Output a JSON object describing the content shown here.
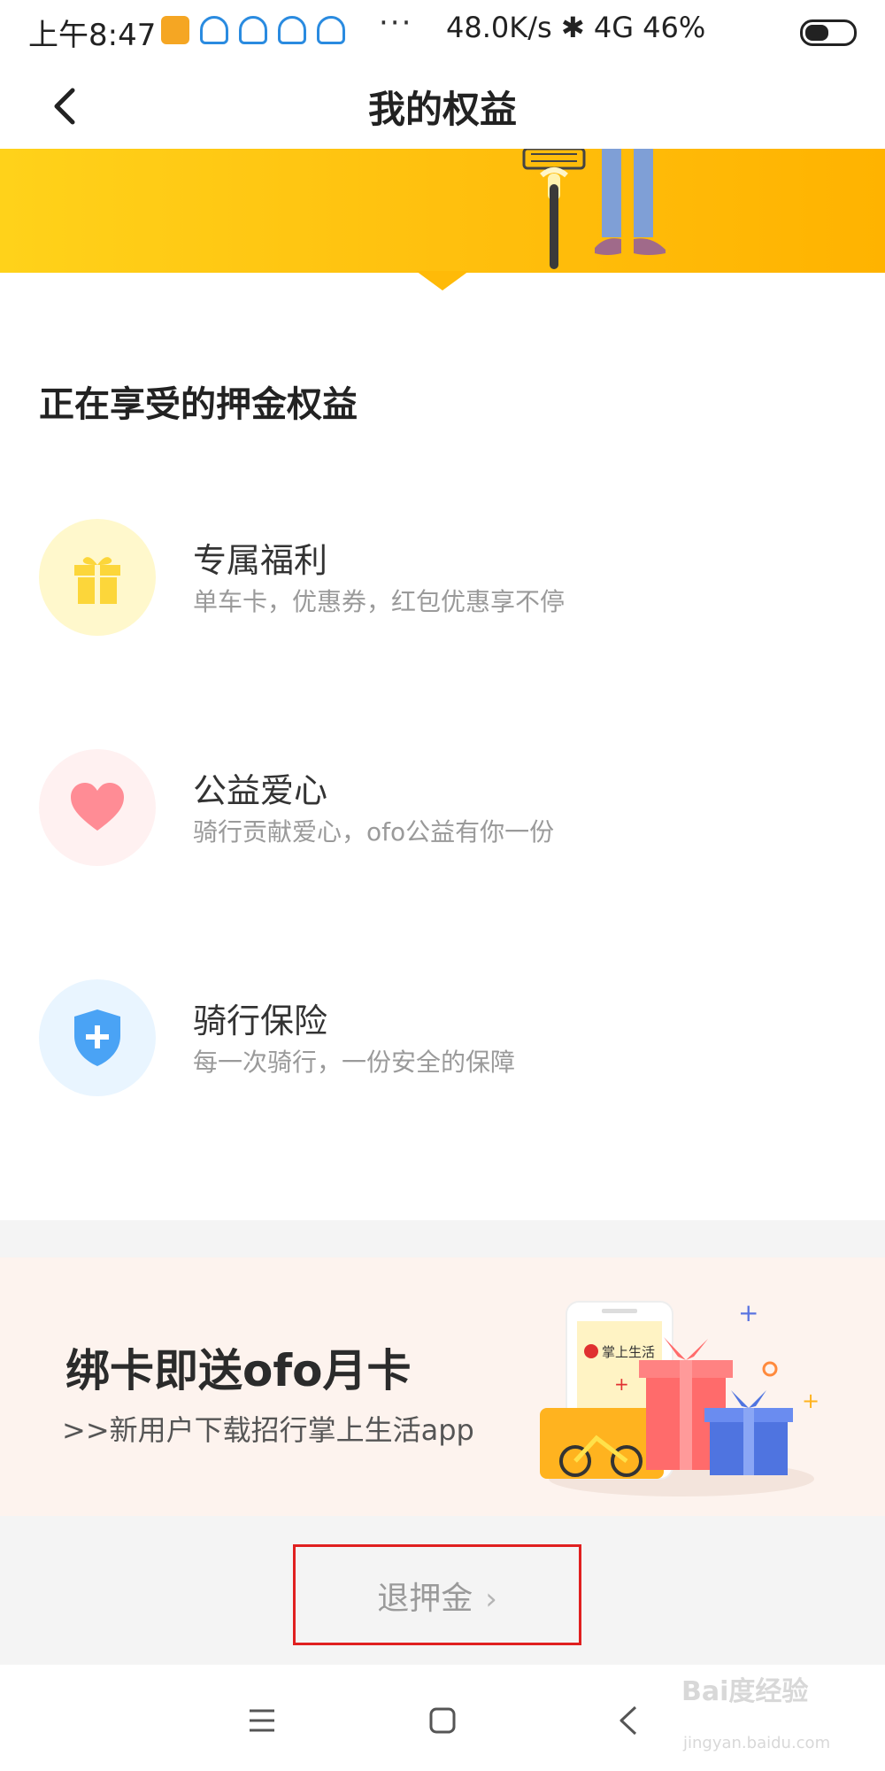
{
  "status_bar": {
    "time": "上午8:47",
    "dots": "···",
    "network": "48.0K/s ✱ 4G 46%"
  },
  "header": {
    "title": "我的权益",
    "back_icon": "chevron-left-icon"
  },
  "section": {
    "title": "正在享受的押金权益"
  },
  "benefits": [
    {
      "title": "专属福利",
      "desc": "单车卡，优惠券，红包优惠享不停",
      "icon": "gift-icon",
      "color": "#fcd63a"
    },
    {
      "title": "公益爱心",
      "desc": "骑行贡献爱心，ofo公益有你一份",
      "icon": "heart-icon",
      "color": "#ff8c95"
    },
    {
      "title": "骑行保险",
      "desc": "每一次骑行，一份安全的保障",
      "icon": "shield-icon",
      "color": "#4aa3f5"
    }
  ],
  "promo": {
    "title": "绑卡即送ofo月卡",
    "subtitle": ">>新用户下载招行掌上生活app",
    "phone_label": "掌上生活"
  },
  "refund": {
    "label": "退押金"
  },
  "watermark": {
    "text": "Bai度经验",
    "sub": "jingyan.baidu.com"
  },
  "colors": {
    "brand_yellow": "#ffc00e",
    "highlight_red": "#e02020"
  }
}
